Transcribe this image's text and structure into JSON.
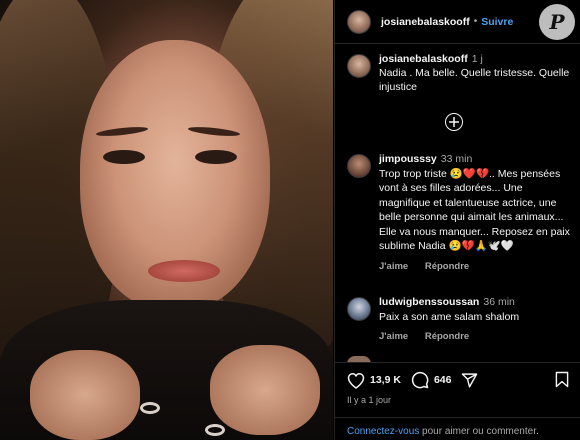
{
  "post": {
    "author": "josianebalaskooff",
    "follow_label": "Suivre",
    "dot": "•",
    "caption_text": "Nadia . Ma belle. Quelle tristesse. Quelle injustice",
    "caption_time": "1 j"
  },
  "logo": {
    "letter": "P"
  },
  "load_more_icon": "plus-circle-icon",
  "comments": [
    {
      "user": "jimpousssy",
      "time": "33 min",
      "text": "Trop trop triste 😢❤️💔.. Mes pensées vont à ses filles adorées... Une magnifique et talentueuse actrice, une belle personne qui aimait les animaux... Elle va nous manquer... Reposez en paix sublime Nadia 😢💔🙏🕊️🤍",
      "like_label": "J'aime",
      "reply_label": "Répondre"
    },
    {
      "user": "ludwigbenssoussan",
      "time": "36 min",
      "text": "Paix a son ame salam shalom",
      "like_label": "J'aime",
      "reply_label": "Répondre"
    }
  ],
  "stats": {
    "likes": "13,9 K",
    "comments": "646"
  },
  "posted_ago": "Il y a 1 jour",
  "login": {
    "link": "Connectez-vous",
    "text": " pour aimer ou commenter."
  },
  "colors": {
    "background": "#000000",
    "text": "#f5f5f5",
    "muted": "#a8a8a8",
    "link": "#4aa3f5"
  }
}
